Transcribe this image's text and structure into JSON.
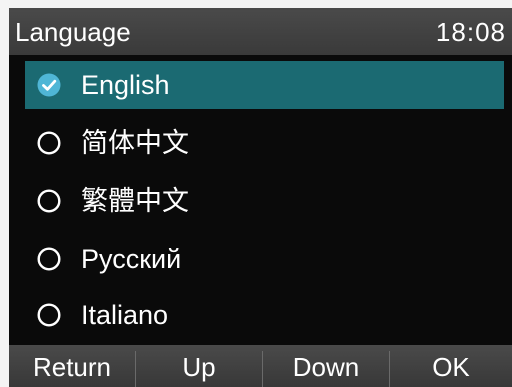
{
  "header": {
    "title": "Language",
    "time": "18:08"
  },
  "languages": [
    {
      "label": "English",
      "selected": true
    },
    {
      "label": "简体中文",
      "selected": false
    },
    {
      "label": "繁體中文",
      "selected": false
    },
    {
      "label": "Русский",
      "selected": false
    },
    {
      "label": "Italiano",
      "selected": false
    }
  ],
  "softkeys": [
    "Return",
    "Up",
    "Down",
    "OK"
  ],
  "icons": {
    "selected": "check-circle-icon",
    "unselected": "radio-empty-icon"
  },
  "colors": {
    "selection": "#1b6a72",
    "check_fill": "#4fb6d6"
  }
}
